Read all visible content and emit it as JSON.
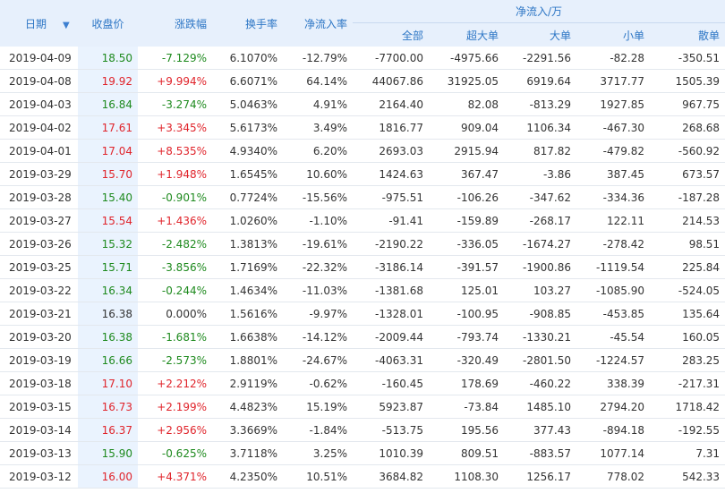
{
  "headers": {
    "date": "日期",
    "close": "收盘价",
    "change": "涨跌幅",
    "turnover": "换手率",
    "net_ratio": "净流入率",
    "net_group": "净流入/万",
    "all": "全部",
    "super_large": "超大单",
    "large": "大单",
    "small": "小单",
    "retail": "散单"
  },
  "colors": {
    "up": "#e0242b",
    "down": "#1e8a1e",
    "header_text": "#2d76c5",
    "header_bg": "#e7f0fc"
  },
  "sort_icon": "sort-down-arrow-icon",
  "rows": [
    {
      "date": "2019-04-09",
      "close": "18.50",
      "change": "-7.129%",
      "turnover": "6.1070%",
      "net_ratio": "-12.79%",
      "all": "-7700.00",
      "super_large": "-4975.66",
      "large": "-2291.56",
      "small": "-82.28",
      "retail": "-350.51",
      "dir": "down"
    },
    {
      "date": "2019-04-08",
      "close": "19.92",
      "change": "+9.994%",
      "turnover": "6.6071%",
      "net_ratio": "64.14%",
      "all": "44067.86",
      "super_large": "31925.05",
      "large": "6919.64",
      "small": "3717.77",
      "retail": "1505.39",
      "dir": "up"
    },
    {
      "date": "2019-04-03",
      "close": "16.84",
      "change": "-3.274%",
      "turnover": "5.0463%",
      "net_ratio": "4.91%",
      "all": "2164.40",
      "super_large": "82.08",
      "large": "-813.29",
      "small": "1927.85",
      "retail": "967.75",
      "dir": "down"
    },
    {
      "date": "2019-04-02",
      "close": "17.61",
      "change": "+3.345%",
      "turnover": "5.6173%",
      "net_ratio": "3.49%",
      "all": "1816.77",
      "super_large": "909.04",
      "large": "1106.34",
      "small": "-467.30",
      "retail": "268.68",
      "dir": "up"
    },
    {
      "date": "2019-04-01",
      "close": "17.04",
      "change": "+8.535%",
      "turnover": "4.9340%",
      "net_ratio": "6.20%",
      "all": "2693.03",
      "super_large": "2915.94",
      "large": "817.82",
      "small": "-479.82",
      "retail": "-560.92",
      "dir": "up"
    },
    {
      "date": "2019-03-29",
      "close": "15.70",
      "change": "+1.948%",
      "turnover": "1.6545%",
      "net_ratio": "10.60%",
      "all": "1424.63",
      "super_large": "367.47",
      "large": "-3.86",
      "small": "387.45",
      "retail": "673.57",
      "dir": "up"
    },
    {
      "date": "2019-03-28",
      "close": "15.40",
      "change": "-0.901%",
      "turnover": "0.7724%",
      "net_ratio": "-15.56%",
      "all": "-975.51",
      "super_large": "-106.26",
      "large": "-347.62",
      "small": "-334.36",
      "retail": "-187.28",
      "dir": "down"
    },
    {
      "date": "2019-03-27",
      "close": "15.54",
      "change": "+1.436%",
      "turnover": "1.0260%",
      "net_ratio": "-1.10%",
      "all": "-91.41",
      "super_large": "-159.89",
      "large": "-268.17",
      "small": "122.11",
      "retail": "214.53",
      "dir": "up"
    },
    {
      "date": "2019-03-26",
      "close": "15.32",
      "change": "-2.482%",
      "turnover": "1.3813%",
      "net_ratio": "-19.61%",
      "all": "-2190.22",
      "super_large": "-336.05",
      "large": "-1674.27",
      "small": "-278.42",
      "retail": "98.51",
      "dir": "down"
    },
    {
      "date": "2019-03-25",
      "close": "15.71",
      "change": "-3.856%",
      "turnover": "1.7169%",
      "net_ratio": "-22.32%",
      "all": "-3186.14",
      "super_large": "-391.57",
      "large": "-1900.86",
      "small": "-1119.54",
      "retail": "225.84",
      "dir": "down"
    },
    {
      "date": "2019-03-22",
      "close": "16.34",
      "change": "-0.244%",
      "turnover": "1.4634%",
      "net_ratio": "-11.03%",
      "all": "-1381.68",
      "super_large": "125.01",
      "large": "103.27",
      "small": "-1085.90",
      "retail": "-524.05",
      "dir": "down"
    },
    {
      "date": "2019-03-21",
      "close": "16.38",
      "change": "0.000%",
      "turnover": "1.5616%",
      "net_ratio": "-9.97%",
      "all": "-1328.01",
      "super_large": "-100.95",
      "large": "-908.85",
      "small": "-453.85",
      "retail": "135.64",
      "dir": "flat"
    },
    {
      "date": "2019-03-20",
      "close": "16.38",
      "change": "-1.681%",
      "turnover": "1.6638%",
      "net_ratio": "-14.12%",
      "all": "-2009.44",
      "super_large": "-793.74",
      "large": "-1330.21",
      "small": "-45.54",
      "retail": "160.05",
      "dir": "down"
    },
    {
      "date": "2019-03-19",
      "close": "16.66",
      "change": "-2.573%",
      "turnover": "1.8801%",
      "net_ratio": "-24.67%",
      "all": "-4063.31",
      "super_large": "-320.49",
      "large": "-2801.50",
      "small": "-1224.57",
      "retail": "283.25",
      "dir": "down"
    },
    {
      "date": "2019-03-18",
      "close": "17.10",
      "change": "+2.212%",
      "turnover": "2.9119%",
      "net_ratio": "-0.62%",
      "all": "-160.45",
      "super_large": "178.69",
      "large": "-460.22",
      "small": "338.39",
      "retail": "-217.31",
      "dir": "up"
    },
    {
      "date": "2019-03-15",
      "close": "16.73",
      "change": "+2.199%",
      "turnover": "4.4823%",
      "net_ratio": "15.19%",
      "all": "5923.87",
      "super_large": "-73.84",
      "large": "1485.10",
      "small": "2794.20",
      "retail": "1718.42",
      "dir": "up"
    },
    {
      "date": "2019-03-14",
      "close": "16.37",
      "change": "+2.956%",
      "turnover": "3.3669%",
      "net_ratio": "-1.84%",
      "all": "-513.75",
      "super_large": "195.56",
      "large": "377.43",
      "small": "-894.18",
      "retail": "-192.55",
      "dir": "up"
    },
    {
      "date": "2019-03-13",
      "close": "15.90",
      "change": "-0.625%",
      "turnover": "3.7118%",
      "net_ratio": "3.25%",
      "all": "1010.39",
      "super_large": "809.51",
      "large": "-883.57",
      "small": "1077.14",
      "retail": "7.31",
      "dir": "down"
    },
    {
      "date": "2019-03-12",
      "close": "16.00",
      "change": "+4.371%",
      "turnover": "4.2350%",
      "net_ratio": "10.51%",
      "all": "3684.82",
      "super_large": "1108.30",
      "large": "1256.17",
      "small": "778.02",
      "retail": "542.33",
      "dir": "up"
    }
  ]
}
